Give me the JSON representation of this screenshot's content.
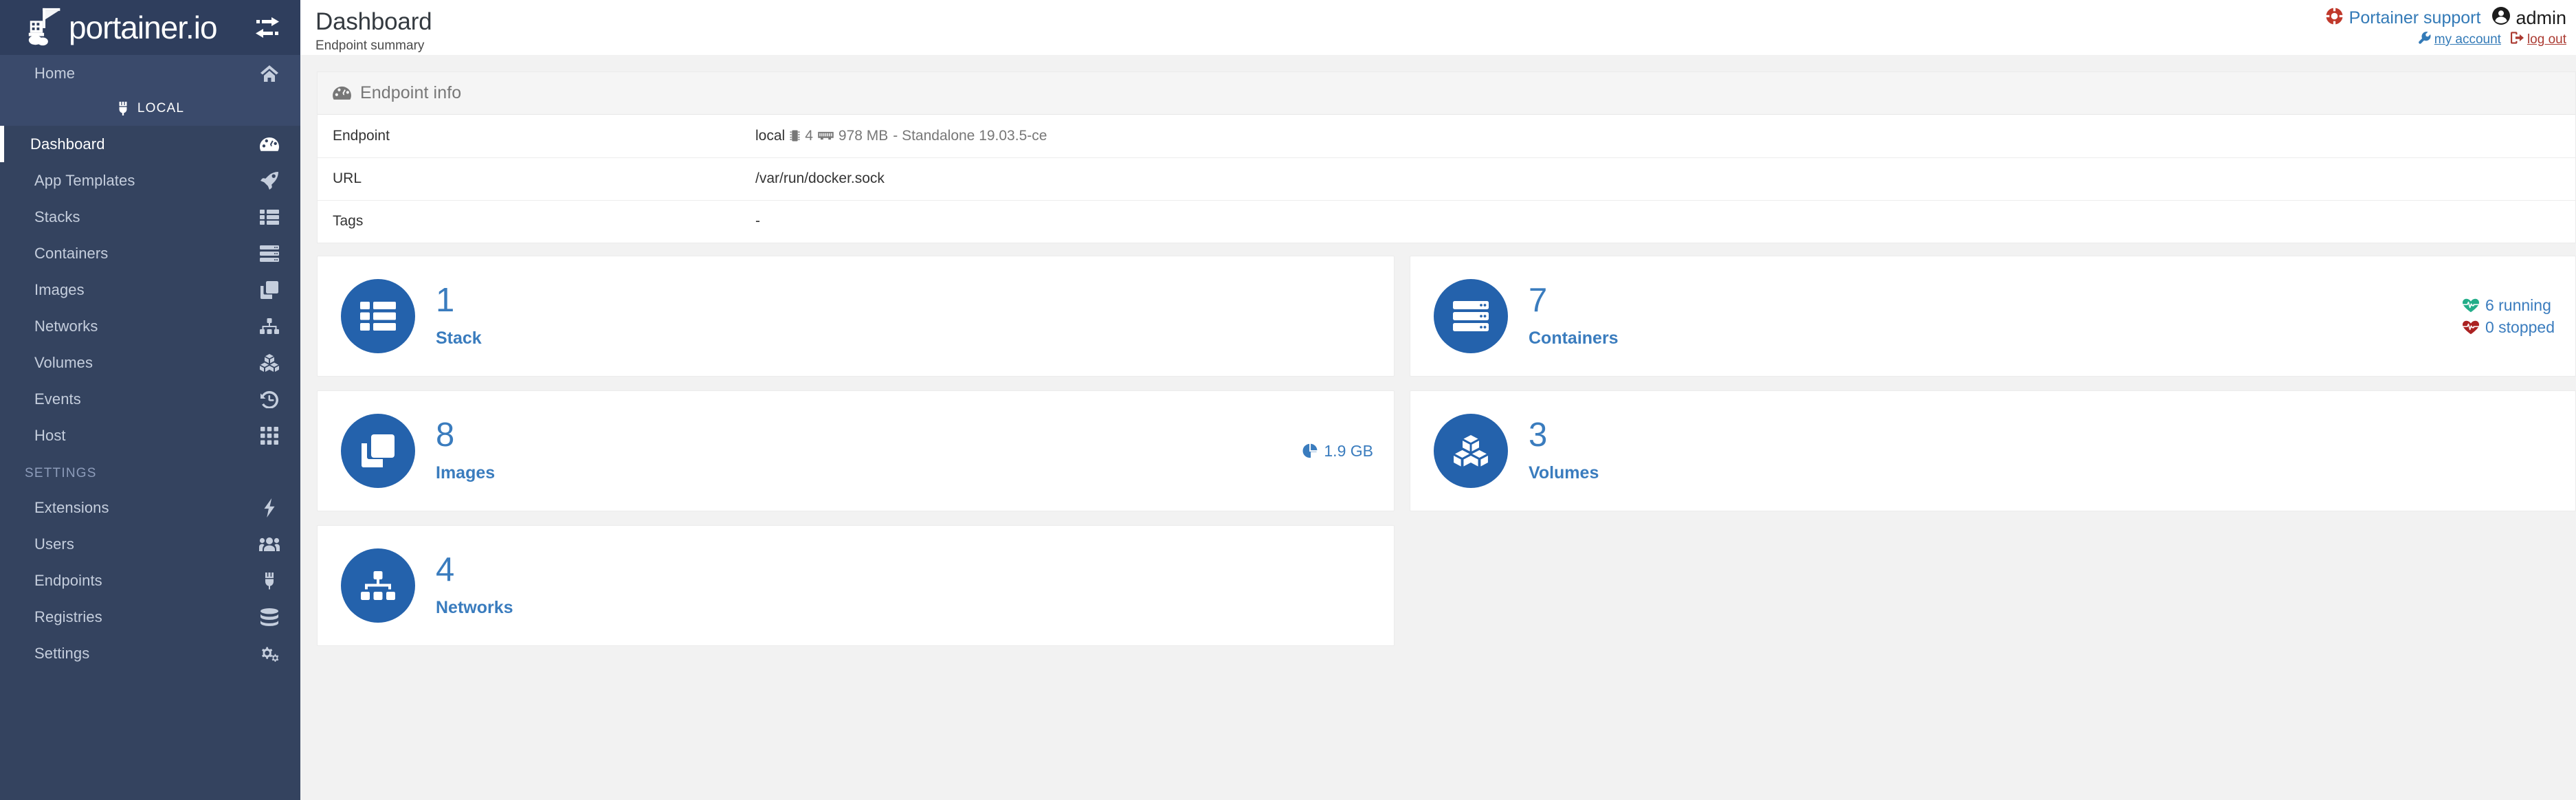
{
  "brand": {
    "name": "portainer.io",
    "toggle_icon": "collapse-arrows-icon"
  },
  "sidebar": {
    "home": {
      "label": "Home",
      "icon": "home-icon"
    },
    "local_badge": {
      "label": "LOCAL",
      "icon": "plug-icon"
    },
    "items": [
      {
        "label": "Dashboard",
        "icon": "dashboard-icon",
        "active": true
      },
      {
        "label": "App Templates",
        "icon": "rocket-icon",
        "active": false
      },
      {
        "label": "Stacks",
        "icon": "list-icon",
        "active": false
      },
      {
        "label": "Containers",
        "icon": "server-icon",
        "active": false
      },
      {
        "label": "Images",
        "icon": "clone-icon",
        "active": false
      },
      {
        "label": "Networks",
        "icon": "sitemap-icon",
        "active": false
      },
      {
        "label": "Volumes",
        "icon": "cubes-icon",
        "active": false
      },
      {
        "label": "Events",
        "icon": "history-icon",
        "active": false
      },
      {
        "label": "Host",
        "icon": "th-grid-icon",
        "active": false
      }
    ],
    "settings_heading": "SETTINGS",
    "settings_items": [
      {
        "label": "Extensions",
        "icon": "bolt-icon"
      },
      {
        "label": "Users",
        "icon": "users-icon"
      },
      {
        "label": "Endpoints",
        "icon": "plug-icon"
      },
      {
        "label": "Registries",
        "icon": "database-icon"
      },
      {
        "label": "Settings",
        "icon": "cogs-icon"
      }
    ]
  },
  "header": {
    "title": "Dashboard",
    "subtitle": "Endpoint summary",
    "support_label": "Portainer support",
    "support_icon": "life-ring-icon",
    "user_name": "admin",
    "user_icon": "user-circle-icon",
    "my_account_label": "my account",
    "my_account_icon": "wrench-icon",
    "log_out_label": "log out",
    "log_out_icon": "sign-out-icon"
  },
  "endpoint_info": {
    "panel_title": "Endpoint info",
    "panel_icon": "tachometer-icon",
    "rows": [
      {
        "key": "Endpoint",
        "value": "local",
        "cpu": "4",
        "memory": "978 MB",
        "suffix": "- Standalone 19.03.5-ce"
      },
      {
        "key": "URL",
        "value": "/var/run/docker.sock"
      },
      {
        "key": "Tags",
        "value": "-"
      }
    ]
  },
  "stat_cards": [
    {
      "count": "1",
      "label": "Stack",
      "icon": "stack-icon",
      "aside": []
    },
    {
      "count": "7",
      "label": "Containers",
      "icon": "server-icon",
      "aside": [
        {
          "text": "6 running",
          "icon": "heartbeat-icon",
          "color": "#23ae89"
        },
        {
          "text": "0 stopped",
          "icon": "heartbeat-icon",
          "color": "#ab2222"
        }
      ]
    },
    {
      "count": "8",
      "label": "Images",
      "icon": "clone-icon",
      "aside": [
        {
          "text": "1.9 GB",
          "icon": "pie-chart-icon",
          "color": "#3a7cbe"
        }
      ]
    },
    {
      "count": "3",
      "label": "Volumes",
      "icon": "cubes-icon",
      "aside": []
    },
    {
      "count": "4",
      "label": "Networks",
      "icon": "sitemap-icon",
      "aside": []
    }
  ],
  "colors": {
    "sidebar_bg": "#2f3e5d",
    "sidebar_menu_bg": "#34435f",
    "sidebar_highlight_bg": "#3a4a6b",
    "accent_blue": "#2462ac",
    "link_blue": "#337ab7",
    "text_blue": "#3a7cbe",
    "page_bg": "#f2f2f2",
    "running_green": "#23ae89",
    "stopped_red": "#ab2222"
  }
}
